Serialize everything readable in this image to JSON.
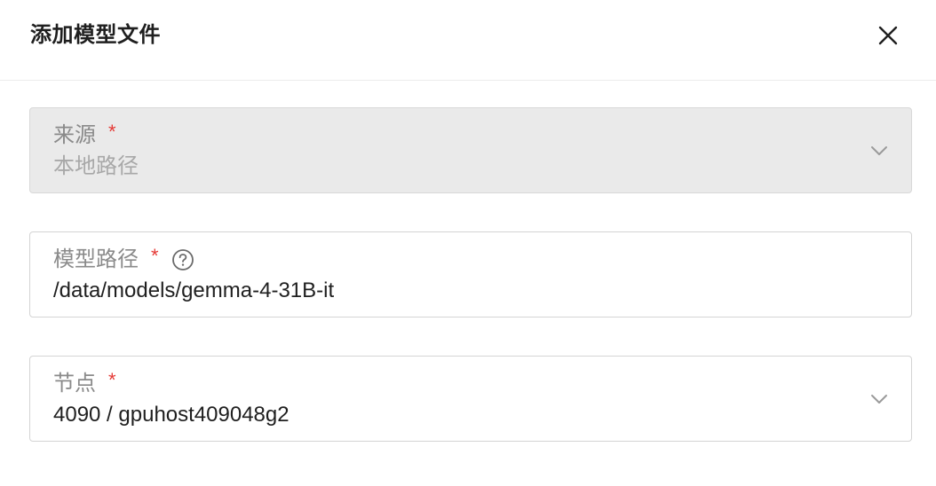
{
  "dialog": {
    "title": "添加模型文件",
    "close_icon": "close-icon"
  },
  "fields": {
    "source": {
      "label": "来源",
      "required_mark": "*",
      "value": "本地路径",
      "disabled": true,
      "icon": "chevron-down-icon"
    },
    "model_path": {
      "label": "模型路径",
      "required_mark": "*",
      "help_icon": "question-circle-icon",
      "value": "/data/models/gemma-4-31B-it"
    },
    "node": {
      "label": "节点",
      "required_mark": "*",
      "value": "4090 / gpuhost409048g2",
      "icon": "chevron-down-icon"
    }
  },
  "colors": {
    "required": "#e53935",
    "label": "#8a8a8a",
    "disabled_bg": "#eaeaea",
    "border": "#d4d4d4"
  }
}
